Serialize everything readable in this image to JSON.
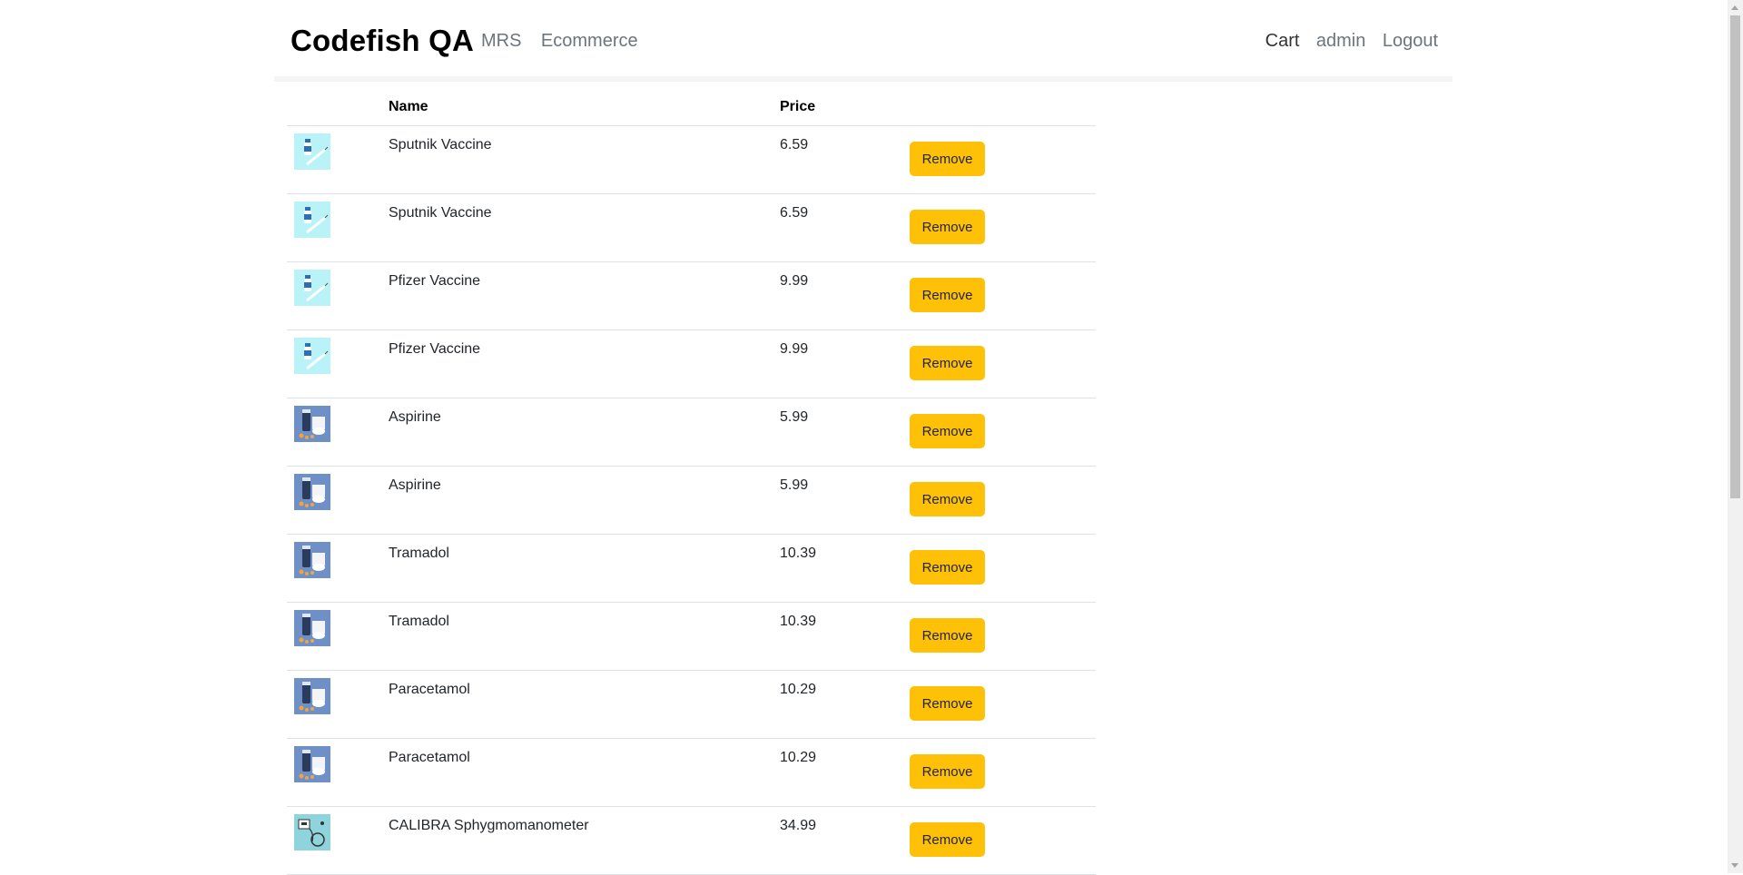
{
  "nav": {
    "brand": "Codefish QA",
    "left_links": [
      "MRS",
      "Ecommerce"
    ],
    "right_links": [
      "Cart",
      "admin",
      "Logout"
    ]
  },
  "table": {
    "headers": [
      "",
      "Name",
      "Price",
      ""
    ],
    "remove_label": "Remove",
    "rows": [
      {
        "name": "Sputnik Vaccine",
        "price": "6.59",
        "icon": "vaccine-thumbnail-icon"
      },
      {
        "name": "Sputnik Vaccine",
        "price": "6.59",
        "icon": "vaccine-thumbnail-icon"
      },
      {
        "name": "Pfizer Vaccine",
        "price": "9.99",
        "icon": "vaccine-thumbnail-icon"
      },
      {
        "name": "Pfizer Vaccine",
        "price": "9.99",
        "icon": "vaccine-thumbnail-icon"
      },
      {
        "name": "Aspirine",
        "price": "5.99",
        "icon": "pills-thumbnail-icon"
      },
      {
        "name": "Aspirine",
        "price": "5.99",
        "icon": "pills-thumbnail-icon"
      },
      {
        "name": "Tramadol",
        "price": "10.39",
        "icon": "pills-thumbnail-icon"
      },
      {
        "name": "Tramadol",
        "price": "10.39",
        "icon": "pills-thumbnail-icon"
      },
      {
        "name": "Paracetamol",
        "price": "10.29",
        "icon": "pills-thumbnail-icon"
      },
      {
        "name": "Paracetamol",
        "price": "10.29",
        "icon": "pills-thumbnail-icon"
      },
      {
        "name": "CALIBRA Sphygmomanometer",
        "price": "34.99",
        "icon": "blood-pressure-monitor-thumbnail-icon"
      }
    ]
  },
  "colors": {
    "remove_button": "#ffc107",
    "vaccine_bg": "#b9f3f7",
    "pills_bg": "#6f8fc7",
    "monitor_bg": "#8fd3dc"
  }
}
